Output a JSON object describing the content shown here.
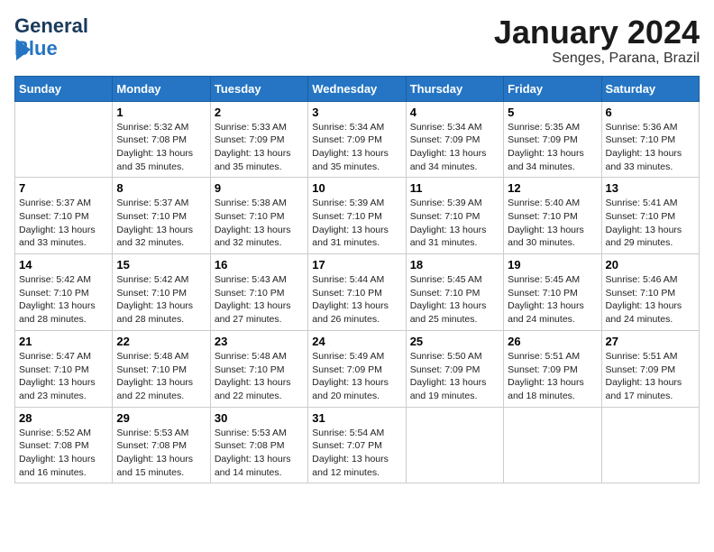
{
  "header": {
    "logo_line1": "General",
    "logo_line2": "Blue",
    "month": "January 2024",
    "location": "Senges, Parana, Brazil"
  },
  "weekdays": [
    "Sunday",
    "Monday",
    "Tuesday",
    "Wednesday",
    "Thursday",
    "Friday",
    "Saturday"
  ],
  "weeks": [
    [
      {
        "day": "",
        "info": ""
      },
      {
        "day": "1",
        "info": "Sunrise: 5:32 AM\nSunset: 7:08 PM\nDaylight: 13 hours\nand 35 minutes."
      },
      {
        "day": "2",
        "info": "Sunrise: 5:33 AM\nSunset: 7:09 PM\nDaylight: 13 hours\nand 35 minutes."
      },
      {
        "day": "3",
        "info": "Sunrise: 5:34 AM\nSunset: 7:09 PM\nDaylight: 13 hours\nand 35 minutes."
      },
      {
        "day": "4",
        "info": "Sunrise: 5:34 AM\nSunset: 7:09 PM\nDaylight: 13 hours\nand 34 minutes."
      },
      {
        "day": "5",
        "info": "Sunrise: 5:35 AM\nSunset: 7:09 PM\nDaylight: 13 hours\nand 34 minutes."
      },
      {
        "day": "6",
        "info": "Sunrise: 5:36 AM\nSunset: 7:10 PM\nDaylight: 13 hours\nand 33 minutes."
      }
    ],
    [
      {
        "day": "7",
        "info": "Sunrise: 5:37 AM\nSunset: 7:10 PM\nDaylight: 13 hours\nand 33 minutes."
      },
      {
        "day": "8",
        "info": "Sunrise: 5:37 AM\nSunset: 7:10 PM\nDaylight: 13 hours\nand 32 minutes."
      },
      {
        "day": "9",
        "info": "Sunrise: 5:38 AM\nSunset: 7:10 PM\nDaylight: 13 hours\nand 32 minutes."
      },
      {
        "day": "10",
        "info": "Sunrise: 5:39 AM\nSunset: 7:10 PM\nDaylight: 13 hours\nand 31 minutes."
      },
      {
        "day": "11",
        "info": "Sunrise: 5:39 AM\nSunset: 7:10 PM\nDaylight: 13 hours\nand 31 minutes."
      },
      {
        "day": "12",
        "info": "Sunrise: 5:40 AM\nSunset: 7:10 PM\nDaylight: 13 hours\nand 30 minutes."
      },
      {
        "day": "13",
        "info": "Sunrise: 5:41 AM\nSunset: 7:10 PM\nDaylight: 13 hours\nand 29 minutes."
      }
    ],
    [
      {
        "day": "14",
        "info": "Sunrise: 5:42 AM\nSunset: 7:10 PM\nDaylight: 13 hours\nand 28 minutes."
      },
      {
        "day": "15",
        "info": "Sunrise: 5:42 AM\nSunset: 7:10 PM\nDaylight: 13 hours\nand 28 minutes."
      },
      {
        "day": "16",
        "info": "Sunrise: 5:43 AM\nSunset: 7:10 PM\nDaylight: 13 hours\nand 27 minutes."
      },
      {
        "day": "17",
        "info": "Sunrise: 5:44 AM\nSunset: 7:10 PM\nDaylight: 13 hours\nand 26 minutes."
      },
      {
        "day": "18",
        "info": "Sunrise: 5:45 AM\nSunset: 7:10 PM\nDaylight: 13 hours\nand 25 minutes."
      },
      {
        "day": "19",
        "info": "Sunrise: 5:45 AM\nSunset: 7:10 PM\nDaylight: 13 hours\nand 24 minutes."
      },
      {
        "day": "20",
        "info": "Sunrise: 5:46 AM\nSunset: 7:10 PM\nDaylight: 13 hours\nand 24 minutes."
      }
    ],
    [
      {
        "day": "21",
        "info": "Sunrise: 5:47 AM\nSunset: 7:10 PM\nDaylight: 13 hours\nand 23 minutes."
      },
      {
        "day": "22",
        "info": "Sunrise: 5:48 AM\nSunset: 7:10 PM\nDaylight: 13 hours\nand 22 minutes."
      },
      {
        "day": "23",
        "info": "Sunrise: 5:48 AM\nSunset: 7:10 PM\nDaylight: 13 hours\nand 22 minutes."
      },
      {
        "day": "24",
        "info": "Sunrise: 5:49 AM\nSunset: 7:09 PM\nDaylight: 13 hours\nand 20 minutes."
      },
      {
        "day": "25",
        "info": "Sunrise: 5:50 AM\nSunset: 7:09 PM\nDaylight: 13 hours\nand 19 minutes."
      },
      {
        "day": "26",
        "info": "Sunrise: 5:51 AM\nSunset: 7:09 PM\nDaylight: 13 hours\nand 18 minutes."
      },
      {
        "day": "27",
        "info": "Sunrise: 5:51 AM\nSunset: 7:09 PM\nDaylight: 13 hours\nand 17 minutes."
      }
    ],
    [
      {
        "day": "28",
        "info": "Sunrise: 5:52 AM\nSunset: 7:08 PM\nDaylight: 13 hours\nand 16 minutes."
      },
      {
        "day": "29",
        "info": "Sunrise: 5:53 AM\nSunset: 7:08 PM\nDaylight: 13 hours\nand 15 minutes."
      },
      {
        "day": "30",
        "info": "Sunrise: 5:53 AM\nSunset: 7:08 PM\nDaylight: 13 hours\nand 14 minutes."
      },
      {
        "day": "31",
        "info": "Sunrise: 5:54 AM\nSunset: 7:07 PM\nDaylight: 13 hours\nand 12 minutes."
      },
      {
        "day": "",
        "info": ""
      },
      {
        "day": "",
        "info": ""
      },
      {
        "day": "",
        "info": ""
      }
    ]
  ]
}
